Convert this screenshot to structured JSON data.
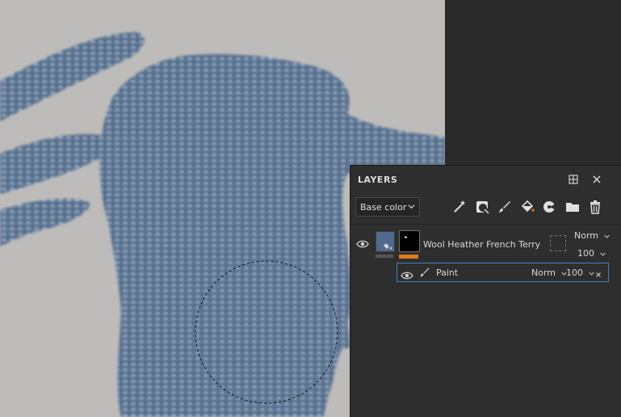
{
  "panel": {
    "title": "LAYERS"
  },
  "toolbar": {
    "channel_select": "Base color",
    "tools": [
      "magic-wand-icon",
      "mask-icon",
      "paint-brush-icon",
      "fill-bucket-icon",
      "effect-icon",
      "folder-icon",
      "trash-icon"
    ]
  },
  "layer": {
    "name": "Wool Heather French Terry",
    "blend_mode": "Norm",
    "opacity": "100",
    "color_swatch": "#4f6a8c",
    "mask_bar_color": "#e07a1f"
  },
  "sublayer": {
    "name": "Paint",
    "blend_mode": "Norm",
    "opacity": "100"
  },
  "colors": {
    "selection_border": "#3d84c8",
    "canvas_bg": "#bebcba",
    "fabric": "#3f5a78"
  }
}
